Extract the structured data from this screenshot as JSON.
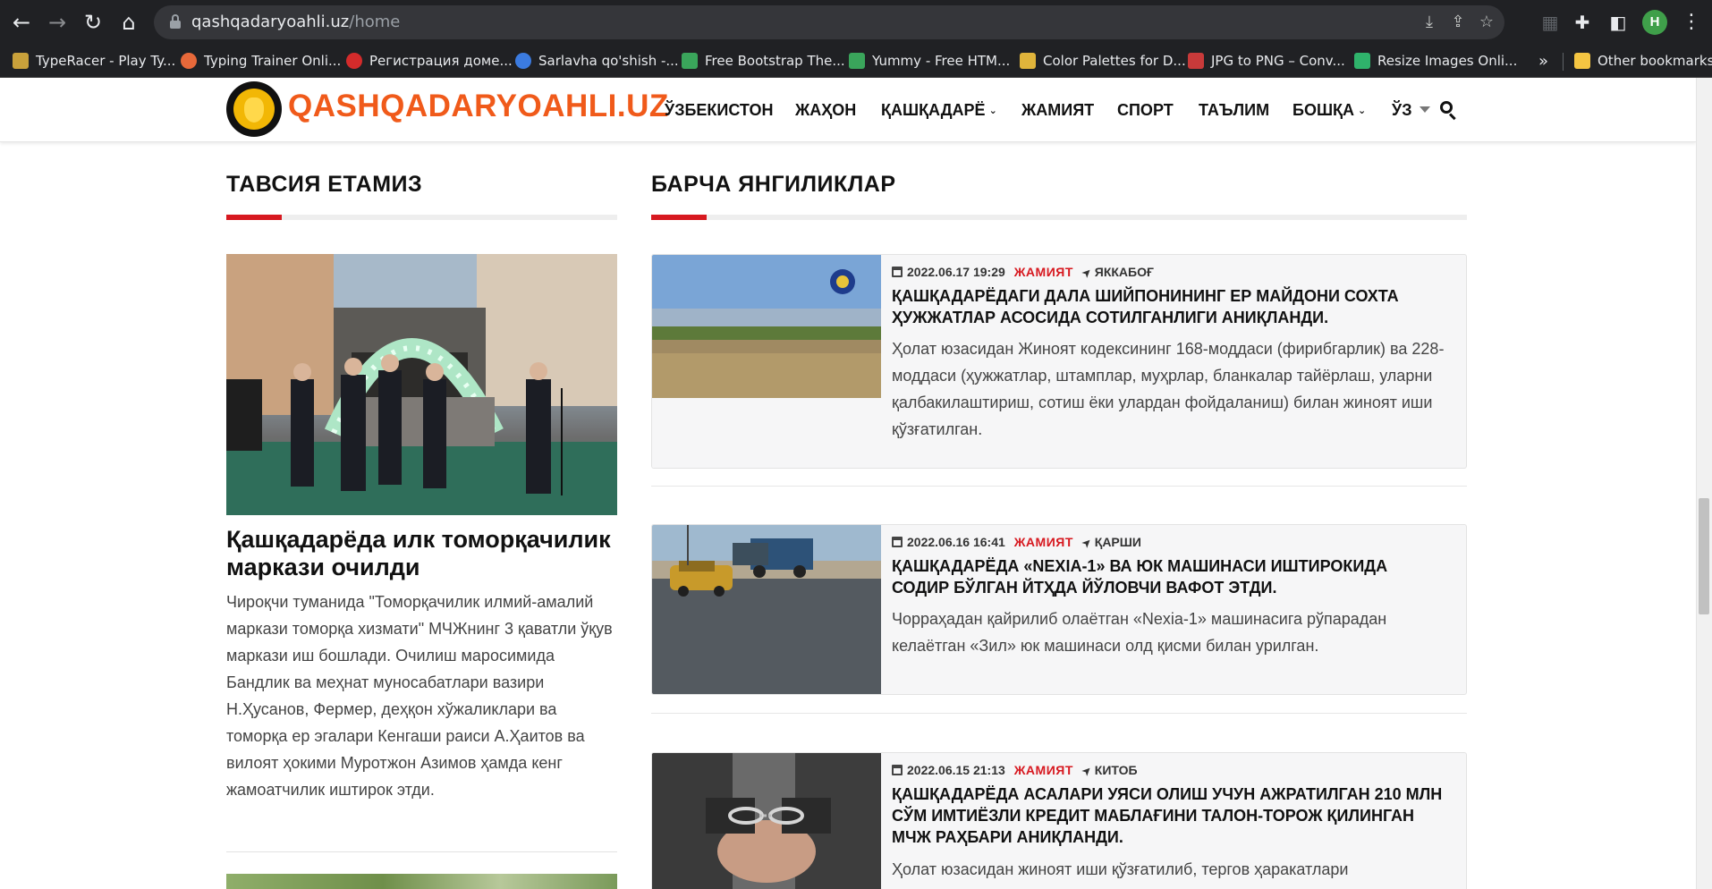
{
  "browser": {
    "url_host": "qashqadaryoahli.uz",
    "url_path": "/home",
    "profile_initial": "H",
    "bookmarks": [
      {
        "label": "TypeRacer - Play Ty...",
        "color": "#c9a13b"
      },
      {
        "label": "Typing Trainer Onli...",
        "color": "#e8693a"
      },
      {
        "label": "Регистрация доме...",
        "color": "#d42b2b"
      },
      {
        "label": "Sarlavha qo'shish -...",
        "color": "#3b7be0"
      },
      {
        "label": "Free Bootstrap The...",
        "color": "#3aa55b"
      },
      {
        "label": "Yummy - Free HTM...",
        "color": "#3aa55b"
      },
      {
        "label": "Color Palettes for D...",
        "color": "#e0b43b"
      },
      {
        "label": "JPG to PNG – Conv...",
        "color": "#c83a3a"
      },
      {
        "label": "Resize Images Onli...",
        "color": "#2fb36b"
      }
    ],
    "more_bookmarks": "»",
    "other_bookmarks": "Other bookmarks"
  },
  "site": {
    "logo_text": "QASHQADARYOAHLI.UZ",
    "brand_color": "#f05a1a",
    "accent_color": "#d71920",
    "nav": {
      "uzbekistan": "ЎЗБЕКИСТОН",
      "world": "ЖАҲОН",
      "kashkadarya": "ҚАШҚАДАРЁ",
      "society": "ЖАМИЯТ",
      "sport": "СПОРТ",
      "education": "ТАЪЛИМ",
      "other": "БОШҚА",
      "language": "ЎЗ"
    }
  },
  "recommended": {
    "heading": "ТАВСИЯ ЕТАМИЗ",
    "title": "Қашқадарёда илк томорқачилик маркази очилди",
    "excerpt": "Чироқчи туманида \"Томорқачилик илмий-амалий маркази томорқа хизмати\" МЧЖнинг 3 қаватли ўқув маркази иш бошлади. Очилиш маросимида Бандлик ва меҳнат муносабатлари вазири Н.Ҳусанов, Фермер, деҳқон хўжаликлари ва томорқа ер эгалари Кенгаши раиси А.Ҳаитов ва вилоят ҳокими Муротжон Азимов ҳамда кенг жамоатчилик иштирок этди."
  },
  "all_news": {
    "heading": "БАРЧА ЯНГИЛИКЛАР",
    "items": [
      {
        "date": "2022.06.17 19:29",
        "category": "ЖАМИЯТ",
        "location": "ЯККАБОҒ",
        "title": "Қашқадарёдаги дала шийпонининг ер майдони сохта ҳужжатлар асосида сотилганлиги аниқланди.",
        "excerpt": "Ҳолат юзасидан Жиноят кодексининг 168-моддаси (фирибгарлик) ва 228-моддаси (ҳужжатлар, штамплар, муҳрлар, бланкалар тайёрлаш, уларни қалбакилаштириш, сотиш ёки улардан фойдаланиш) билан жиноят иши қўзғатилган."
      },
      {
        "date": "2022.06.16 16:41",
        "category": "ЖАМИЯТ",
        "location": "ҚАРШИ",
        "title": "Қашқадарёда «Nexia-1» ва юк машинаси иштирокида содир бўлган йтҳда йўловчи вафот этди.",
        "excerpt": "Чорраҳадан қайрилиб олаётган «Nexia-1» машинасига рўпарадан келаётган «Зил» юк машинаси олд қисми билан урилган."
      },
      {
        "date": "2022.06.15 21:13",
        "category": "ЖАМИЯТ",
        "location": "КИТОБ",
        "title": "Қашқадарёда асалари уяси олиш учун ажратилган 210 млн сўм имтиёзли кредит маблағини талон-торож қилинган МЧЖ раҳбари аниқланди.",
        "excerpt": "Ҳолат юзасидан жиноят иши қўзғатилиб, тергов ҳаракатлари"
      }
    ]
  }
}
